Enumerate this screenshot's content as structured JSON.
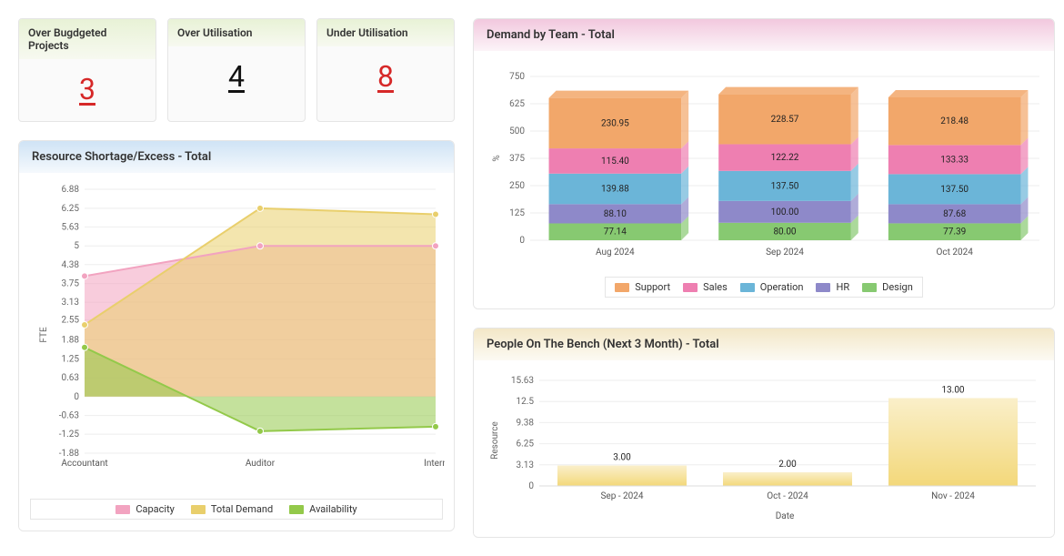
{
  "kpi": [
    {
      "label": "Over Bugdgeted Projects",
      "value": "3",
      "cls": "kpi-red",
      "name": "kpi-over-budget"
    },
    {
      "label": "Over Utilisation",
      "value": "4",
      "cls": "kpi-black",
      "name": "kpi-over-utilisation"
    },
    {
      "label": "Under Utilisation",
      "value": "8",
      "cls": "kpi-red",
      "name": "kpi-under-utilisation"
    }
  ],
  "resource": {
    "title": "Resource Shortage/Excess - Total",
    "ylabel": "FTE",
    "yticks": [
      "6.88",
      "6.25",
      "5.63",
      "5",
      "4.38",
      "3.75",
      "3.13",
      "2.55",
      "1.88",
      "1.25",
      "0.63",
      "0",
      "-0.63",
      "-1.25",
      "-1.88"
    ],
    "xcats": [
      "Accountant",
      "Auditor",
      "Intern"
    ],
    "legend": [
      {
        "name": "Capacity",
        "color": "#f2a3c0"
      },
      {
        "name": "Total Demand",
        "color": "#e9cf6c"
      },
      {
        "name": "Availability",
        "color": "#93c94a"
      }
    ]
  },
  "demand": {
    "title": "Demand by Team - Total",
    "ylabel": "%",
    "yticks": [
      "750",
      "625",
      "500",
      "375",
      "250",
      "125",
      "0"
    ],
    "xcats": [
      "Aug 2024",
      "Sep 2024",
      "Oct 2024"
    ],
    "legend": [
      {
        "name": "Support",
        "color": "#f2a76a"
      },
      {
        "name": "Sales",
        "color": "#ee7fb1"
      },
      {
        "name": "Operation",
        "color": "#6bb5d8"
      },
      {
        "name": "HR",
        "color": "#8e89c9"
      },
      {
        "name": "Design",
        "color": "#87c971"
      }
    ]
  },
  "bench": {
    "title": "People On The Bench (Next 3 Month) - Total",
    "ylabel": "Resource",
    "xlabel": "Date",
    "yticks": [
      "15.63",
      "12.5",
      "9.38",
      "6.25",
      "3.13",
      "0"
    ],
    "labels": [
      "3.00",
      "2.00",
      "13.00"
    ],
    "xcats": [
      "Sep - 2024",
      "Oct - 2024",
      "Nov - 2024"
    ]
  },
  "chart_data": [
    {
      "id": "resource_shortage_excess",
      "type": "area",
      "title": "Resource Shortage/Excess - Total",
      "xlabel": "",
      "ylabel": "FTE",
      "ylim": [
        -1.88,
        6.88
      ],
      "categories": [
        "Accountant",
        "Auditor",
        "Intern"
      ],
      "series": [
        {
          "name": "Capacity",
          "color": "#f2a3c0",
          "values": [
            4.0,
            5.0,
            5.0
          ]
        },
        {
          "name": "Total Demand",
          "color": "#e9cf6c",
          "values": [
            2.38,
            6.25,
            6.05
          ]
        },
        {
          "name": "Availability",
          "color": "#93c94a",
          "values": [
            1.63,
            -1.15,
            -1.0
          ]
        }
      ]
    },
    {
      "id": "demand_by_team",
      "type": "bar",
      "stacked": true,
      "title": "Demand by Team - Total",
      "xlabel": "",
      "ylabel": "%",
      "ylim": [
        0,
        750
      ],
      "categories": [
        "Aug 2024",
        "Sep 2024",
        "Oct 2024"
      ],
      "series": [
        {
          "name": "Design",
          "color": "#87c971",
          "values": [
            77.14,
            80.0,
            77.39
          ]
        },
        {
          "name": "HR",
          "color": "#8e89c9",
          "values": [
            88.1,
            100.0,
            87.68
          ]
        },
        {
          "name": "Operation",
          "color": "#6bb5d8",
          "values": [
            139.88,
            137.5,
            137.5
          ]
        },
        {
          "name": "Sales",
          "color": "#ee7fb1",
          "values": [
            115.4,
            122.22,
            133.33
          ]
        },
        {
          "name": "Support",
          "color": "#f2a76a",
          "values": [
            230.95,
            228.57,
            218.48
          ]
        }
      ]
    },
    {
      "id": "people_on_bench",
      "type": "bar",
      "title": "People On The Bench (Next 3 Month) - Total",
      "xlabel": "Date",
      "ylabel": "Resource",
      "ylim": [
        0,
        15.63
      ],
      "categories": [
        "Sep - 2024",
        "Oct - 2024",
        "Nov - 2024"
      ],
      "values": [
        3.0,
        2.0,
        13.0
      ],
      "color": "#f3d87a"
    }
  ]
}
